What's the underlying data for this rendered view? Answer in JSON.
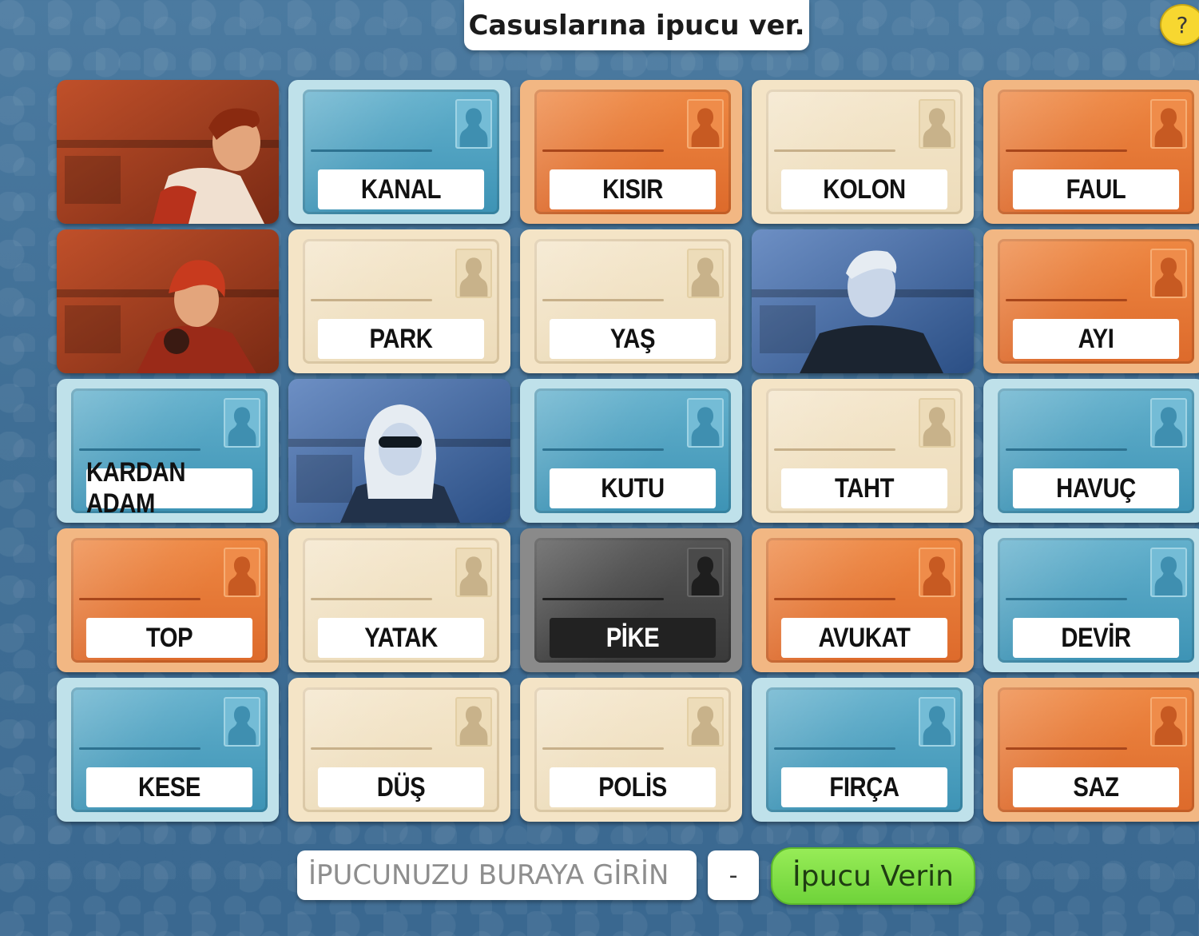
{
  "header": {
    "instruction": "Casuslarına ipucu ver.",
    "help_label": "?"
  },
  "board": {
    "cards": [
      {
        "word": "",
        "color": "red",
        "revealed": true,
        "agent": "red-agent-male"
      },
      {
        "word": "KANAL",
        "color": "blue",
        "revealed": false
      },
      {
        "word": "KISIR",
        "color": "red",
        "revealed": false
      },
      {
        "word": "KOLON",
        "color": "neutral",
        "revealed": false
      },
      {
        "word": "FAUL",
        "color": "red",
        "revealed": false
      },
      {
        "word": "",
        "color": "red",
        "revealed": true,
        "agent": "red-agent-female"
      },
      {
        "word": "PARK",
        "color": "neutral",
        "revealed": false
      },
      {
        "word": "YAŞ",
        "color": "neutral",
        "revealed": false
      },
      {
        "word": "",
        "color": "blue",
        "revealed": true,
        "agent": "blue-agent-male"
      },
      {
        "word": "AYI",
        "color": "red",
        "revealed": false
      },
      {
        "word": "KARDAN ADAM",
        "color": "blue",
        "revealed": false
      },
      {
        "word": "",
        "color": "blue",
        "revealed": true,
        "agent": "blue-agent-female"
      },
      {
        "word": "KUTU",
        "color": "blue",
        "revealed": false
      },
      {
        "word": "TAHT",
        "color": "neutral",
        "revealed": false
      },
      {
        "word": "HAVUÇ",
        "color": "blue",
        "revealed": false
      },
      {
        "word": "TOP",
        "color": "red",
        "revealed": false
      },
      {
        "word": "YATAK",
        "color": "neutral",
        "revealed": false
      },
      {
        "word": "PİKE",
        "color": "assassin",
        "revealed": false
      },
      {
        "word": "AVUKAT",
        "color": "red",
        "revealed": false
      },
      {
        "word": "DEVİR",
        "color": "blue",
        "revealed": false
      },
      {
        "word": "KESE",
        "color": "blue",
        "revealed": false
      },
      {
        "word": "DÜŞ",
        "color": "neutral",
        "revealed": false
      },
      {
        "word": "POLİS",
        "color": "neutral",
        "revealed": false
      },
      {
        "word": "FIRÇA",
        "color": "blue",
        "revealed": false
      },
      {
        "word": "SAZ",
        "color": "red",
        "revealed": false
      }
    ]
  },
  "clue_form": {
    "input_value": "",
    "input_placeholder": "İPUCUNUZU BURAYA GİRİN",
    "count_label": "-",
    "submit_label": "İpucu Verin"
  },
  "colors": {
    "blue_team": "#3d93b5",
    "red_team": "#dd6a2b",
    "neutral": "#eddcba",
    "assassin": "#3a3a3a",
    "submit_green": "#6fd33a"
  }
}
